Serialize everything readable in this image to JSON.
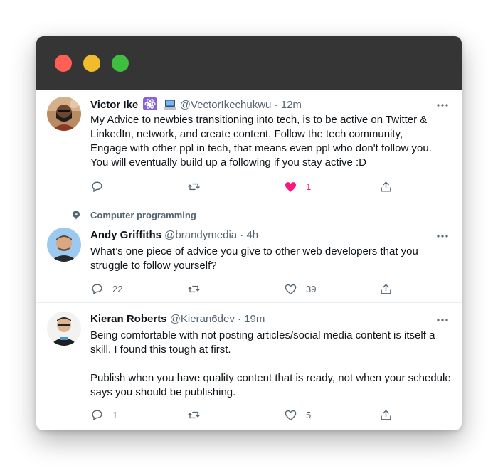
{
  "window": {
    "traffic_lights": [
      "close",
      "minimize",
      "zoom"
    ]
  },
  "colors": {
    "titlebar": "#353535",
    "close": "#ff5f56",
    "minimize": "#f0bc2e",
    "zoom": "#3fbe3f",
    "like_active": "#f91880",
    "secondary_text": "#536471"
  },
  "tweets": [
    {
      "name": "Victor Ike",
      "badges": [
        "atom-emoji",
        "laptop-emoji"
      ],
      "handle": "@VectorIkechukwu",
      "time": "· 12m",
      "text_lines": [
        "My Advice to newbies transitioning into tech, is to be active on Twitter &",
        "LinkedIn, network, and create content. Follow the tech community,",
        "Engage with other ppl in tech, that means even ppl who don't follow you.",
        "You will eventually build up a following if you stay active :D"
      ],
      "replies": "",
      "retweets": "",
      "likes": "1",
      "liked": true
    },
    {
      "context_label": "Computer programming",
      "name": "Andy Griffiths",
      "handle": "@brandymedia",
      "time": "· 4h",
      "text_lines": [
        "What’s one piece of advice you give to other web developers that you",
        "struggle to follow yourself?"
      ],
      "replies": "22",
      "retweets": "",
      "likes": "39",
      "liked": false
    },
    {
      "name": "Kieran Roberts",
      "handle": "@Kieran6dev",
      "time": "· 19m",
      "text_lines": [
        "Being comfortable with not posting articles/social media content is itself a",
        "skill. I found this tough at first.",
        "",
        "Publish when you have quality content that is ready,  not when your schedule",
        "says you should be publishing."
      ],
      "replies": "1",
      "retweets": "",
      "likes": "5",
      "liked": false
    }
  ],
  "icons": {
    "reply": "reply-icon",
    "retweet": "retweet-icon",
    "like": "heart-icon",
    "share": "share-icon",
    "more": "more-icon",
    "topic": "topic-icon"
  }
}
